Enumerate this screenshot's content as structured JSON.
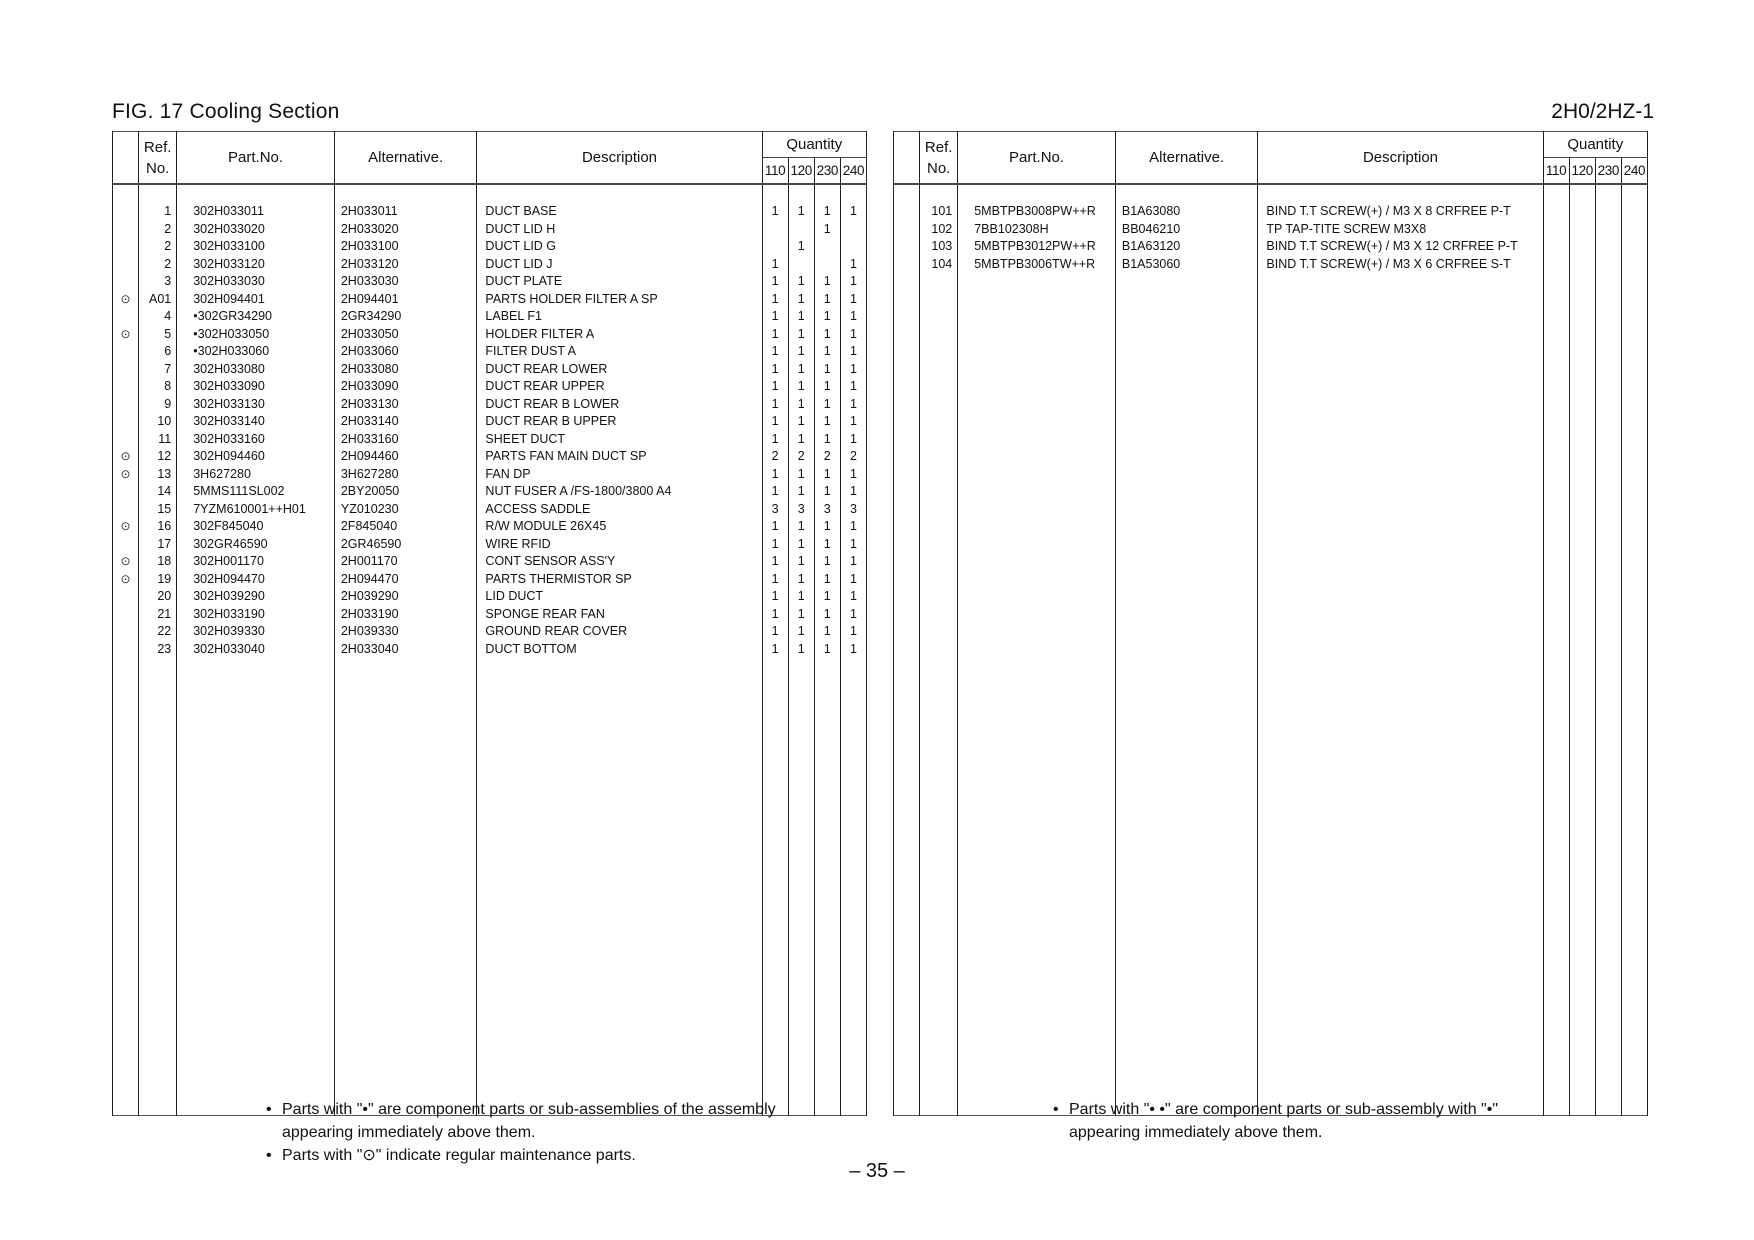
{
  "header": {
    "figure_title": "FIG.  17  Cooling Section",
    "model_code": "2H0/2HZ-1"
  },
  "columns": {
    "ref_line1": "Ref.",
    "ref_line2": "No.",
    "part_no": "Part.No.",
    "alternative": "Alternative.",
    "description": "Description",
    "quantity": "Quantity",
    "qty_variants": [
      "110",
      "120",
      "230",
      "240"
    ]
  },
  "maintenance_mark_symbol": "⊙",
  "left_table": {
    "rows": [
      {
        "mark": "",
        "ref": "1",
        "part_no": "302H033011",
        "alternative": "2H033011",
        "description": "DUCT BASE",
        "qty": [
          "1",
          "1",
          "1",
          "1"
        ]
      },
      {
        "mark": "",
        "ref": "2",
        "part_no": "302H033020",
        "alternative": "2H033020",
        "description": "DUCT LID H",
        "qty": [
          "",
          "",
          "1",
          ""
        ]
      },
      {
        "mark": "",
        "ref": "2",
        "part_no": "302H033100",
        "alternative": "2H033100",
        "description": "DUCT LID G",
        "qty": [
          "",
          "1",
          "",
          ""
        ]
      },
      {
        "mark": "",
        "ref": "2",
        "part_no": "302H033120",
        "alternative": "2H033120",
        "description": "DUCT LID J",
        "qty": [
          "1",
          "",
          "",
          "1"
        ]
      },
      {
        "mark": "",
        "ref": "3",
        "part_no": "302H033030",
        "alternative": "2H033030",
        "description": "DUCT PLATE",
        "qty": [
          "1",
          "1",
          "1",
          "1"
        ]
      },
      {
        "mark": "⊙",
        "ref": "A01",
        "part_no": "302H094401",
        "alternative": "2H094401",
        "description": "PARTS HOLDER FILTER A SP",
        "qty": [
          "1",
          "1",
          "1",
          "1"
        ]
      },
      {
        "mark": "",
        "ref": "4",
        "part_no": "•302GR34290",
        "alternative": "2GR34290",
        "description": "LABEL F1",
        "qty": [
          "1",
          "1",
          "1",
          "1"
        ]
      },
      {
        "mark": "⊙",
        "ref": "5",
        "part_no": "•302H033050",
        "alternative": "2H033050",
        "description": "HOLDER FILTER A",
        "qty": [
          "1",
          "1",
          "1",
          "1"
        ]
      },
      {
        "mark": "",
        "ref": "6",
        "part_no": "•302H033060",
        "alternative": "2H033060",
        "description": "FILTER DUST A",
        "qty": [
          "1",
          "1",
          "1",
          "1"
        ]
      },
      {
        "mark": "",
        "ref": "7",
        "part_no": "302H033080",
        "alternative": "2H033080",
        "description": "DUCT REAR LOWER",
        "qty": [
          "1",
          "1",
          "1",
          "1"
        ]
      },
      {
        "mark": "",
        "ref": "8",
        "part_no": "302H033090",
        "alternative": "2H033090",
        "description": "DUCT REAR UPPER",
        "qty": [
          "1",
          "1",
          "1",
          "1"
        ]
      },
      {
        "mark": "",
        "ref": "9",
        "part_no": "302H033130",
        "alternative": "2H033130",
        "description": "DUCT REAR B LOWER",
        "qty": [
          "1",
          "1",
          "1",
          "1"
        ]
      },
      {
        "mark": "",
        "ref": "10",
        "part_no": "302H033140",
        "alternative": "2H033140",
        "description": "DUCT REAR B UPPER",
        "qty": [
          "1",
          "1",
          "1",
          "1"
        ]
      },
      {
        "mark": "",
        "ref": "11",
        "part_no": "302H033160",
        "alternative": "2H033160",
        "description": "SHEET DUCT",
        "qty": [
          "1",
          "1",
          "1",
          "1"
        ]
      },
      {
        "mark": "⊙",
        "ref": "12",
        "part_no": "302H094460",
        "alternative": "2H094460",
        "description": "PARTS FAN MAIN DUCT SP",
        "qty": [
          "2",
          "2",
          "2",
          "2"
        ]
      },
      {
        "mark": "⊙",
        "ref": "13",
        "part_no": "3H627280",
        "alternative": "3H627280",
        "description": "FAN DP",
        "qty": [
          "1",
          "1",
          "1",
          "1"
        ]
      },
      {
        "mark": "",
        "ref": "14",
        "part_no": "5MMS111SL002",
        "alternative": "2BY20050",
        "description": "NUT FUSER A /FS-1800/3800 A4",
        "qty": [
          "1",
          "1",
          "1",
          "1"
        ]
      },
      {
        "mark": "",
        "ref": "15",
        "part_no": "7YZM610001++H01",
        "alternative": "YZ010230",
        "description": "ACCESS SADDLE",
        "qty": [
          "3",
          "3",
          "3",
          "3"
        ]
      },
      {
        "mark": "⊙",
        "ref": "16",
        "part_no": "302F845040",
        "alternative": "2F845040",
        "description": "R/W MODULE 26X45",
        "qty": [
          "1",
          "1",
          "1",
          "1"
        ]
      },
      {
        "mark": "",
        "ref": "17",
        "part_no": "302GR46590",
        "alternative": "2GR46590",
        "description": "WIRE RFID",
        "qty": [
          "1",
          "1",
          "1",
          "1"
        ]
      },
      {
        "mark": "⊙",
        "ref": "18",
        "part_no": "302H001170",
        "alternative": "2H001170",
        "description": "CONT SENSOR ASS'Y",
        "qty": [
          "1",
          "1",
          "1",
          "1"
        ]
      },
      {
        "mark": "⊙",
        "ref": "19",
        "part_no": "302H094470",
        "alternative": "2H094470",
        "description": "PARTS THERMISTOR SP",
        "qty": [
          "1",
          "1",
          "1",
          "1"
        ]
      },
      {
        "mark": "",
        "ref": "20",
        "part_no": "302H039290",
        "alternative": "2H039290",
        "description": "LID DUCT",
        "qty": [
          "1",
          "1",
          "1",
          "1"
        ]
      },
      {
        "mark": "",
        "ref": "21",
        "part_no": "302H033190",
        "alternative": "2H033190",
        "description": "SPONGE REAR FAN",
        "qty": [
          "1",
          "1",
          "1",
          "1"
        ]
      },
      {
        "mark": "",
        "ref": "22",
        "part_no": "302H039330",
        "alternative": "2H039330",
        "description": "GROUND REAR COVER",
        "qty": [
          "1",
          "1",
          "1",
          "1"
        ]
      },
      {
        "mark": "",
        "ref": "23",
        "part_no": "302H033040",
        "alternative": "2H033040",
        "description": "DUCT BOTTOM",
        "qty": [
          "1",
          "1",
          "1",
          "1"
        ]
      }
    ]
  },
  "right_table": {
    "rows": [
      {
        "mark": "",
        "ref": "101",
        "part_no": "5MBTPB3008PW++R",
        "alternative": "B1A63080",
        "description": "BIND T.T SCREW(+) / M3 X 8 CRFREE P-T",
        "qty": [
          "",
          "",
          "",
          ""
        ]
      },
      {
        "mark": "",
        "ref": "102",
        "part_no": "7BB102308H",
        "alternative": "BB046210",
        "description": "TP TAP-TITE SCREW M3X8",
        "qty": [
          "",
          "",
          "",
          ""
        ]
      },
      {
        "mark": "",
        "ref": "103",
        "part_no": "5MBTPB3012PW++R",
        "alternative": "B1A63120",
        "description": "BIND T.T SCREW(+) / M3 X 12 CRFREE P-T",
        "qty": [
          "",
          "",
          "",
          ""
        ]
      },
      {
        "mark": "",
        "ref": "104",
        "part_no": "5MBTPB3006TW++R",
        "alternative": "B1A53060",
        "description": "BIND T.T SCREW(+) / M3 X 6 CRFREE S-T",
        "qty": [
          "",
          "",
          "",
          ""
        ]
      }
    ]
  },
  "notes": {
    "left": [
      "Parts with \"•\" are component parts or sub-assemblies of the assembly appearing immediately above them.",
      "Parts with \"⊙\" indicate regular maintenance parts."
    ],
    "right": [
      "Parts with \"• •\" are component parts or sub-assembly with \"•\" appearing immediately above them."
    ]
  },
  "footer": {
    "page_number": "– 35 –"
  }
}
